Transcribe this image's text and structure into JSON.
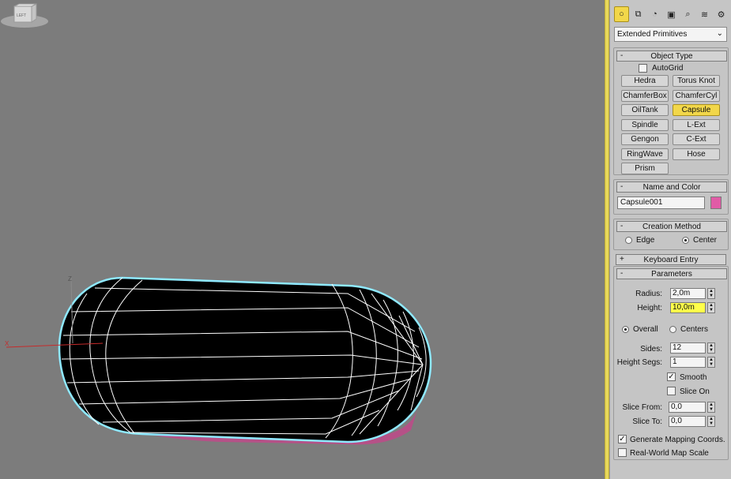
{
  "toolbar": {
    "tabs": [
      {
        "name": "geometry-icon",
        "glyph": "○"
      },
      {
        "name": "shapes-icon",
        "glyph": "⧉"
      },
      {
        "name": "lights-icon",
        "glyph": "◔"
      },
      {
        "name": "cameras-icon",
        "glyph": "▣"
      },
      {
        "name": "helpers-icon",
        "glyph": "⌕"
      },
      {
        "name": "spacewarps-icon",
        "glyph": "≋"
      },
      {
        "name": "systems-icon",
        "glyph": "⚙"
      }
    ]
  },
  "category_dropdown": {
    "value": "Extended Primitives",
    "arrow": "⌄"
  },
  "object_type": {
    "header": "Object Type",
    "sign": "-",
    "autogrid_label": "AutoGrid",
    "buttons": [
      "Hedra",
      "Torus Knot",
      "ChamferBox",
      "ChamferCyl",
      "OilTank",
      "Capsule",
      "Spindle",
      "L-Ext",
      "Gengon",
      "C-Ext",
      "RingWave",
      "Hose",
      "Prism"
    ],
    "active": "Capsule"
  },
  "name_color": {
    "header": "Name and Color",
    "sign": "-",
    "name_value": "Capsule001",
    "color": "#e05ba6"
  },
  "creation_method": {
    "header": "Creation Method",
    "sign": "-",
    "options": [
      "Edge",
      "Center"
    ],
    "selected": "Center"
  },
  "keyboard_entry": {
    "header": "Keyboard Entry",
    "sign": "+"
  },
  "parameters": {
    "header": "Parameters",
    "sign": "-",
    "radius_label": "Radius:",
    "radius_value": "2,0m",
    "height_label": "Height:",
    "height_value": "10,0m",
    "height_mode_options": [
      "Overall",
      "Centers"
    ],
    "height_mode_selected": "Overall",
    "sides_label": "Sides:",
    "sides_value": "12",
    "height_segs_label": "Height Segs:",
    "height_segs_value": "1",
    "smooth_label": "Smooth",
    "smooth_checked": true,
    "slice_on_label": "Slice On",
    "slice_on_checked": false,
    "slice_from_label": "Slice From:",
    "slice_from_value": "0,0",
    "slice_to_label": "Slice To:",
    "slice_to_value": "0,0",
    "gen_mapping_label": "Generate Mapping Coords.",
    "gen_mapping_checked": true,
    "real_world_label": "Real-World Map Scale",
    "real_world_checked": false
  },
  "viewport": {
    "axis_x_label": "X",
    "axis_z_label": "Z",
    "viewcube_label": "LEFT"
  },
  "colors": {
    "accent": "#f2d74a",
    "highlight": "#ffff4a",
    "selection_outline": "#7fe6ff",
    "object_color": "#e05ba6"
  }
}
